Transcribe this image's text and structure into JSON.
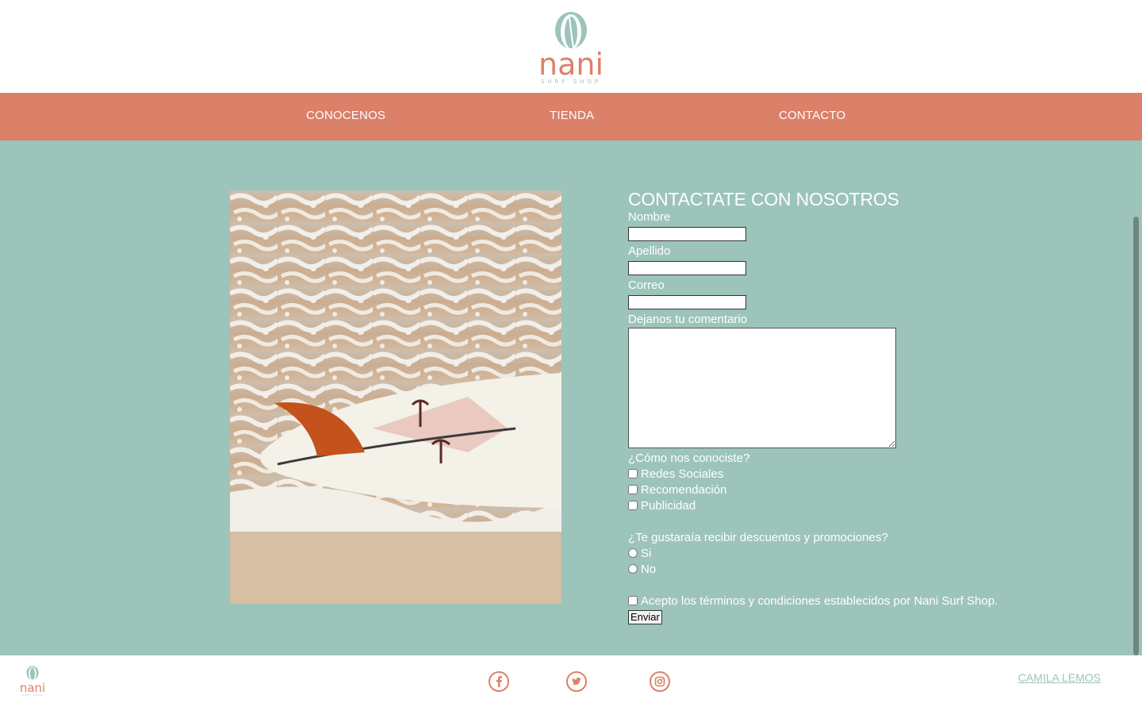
{
  "brand": {
    "name": "nani",
    "tagline": "SURF SHOP"
  },
  "nav": {
    "items": [
      {
        "label": "CONOCENOS"
      },
      {
        "label": "TIENDA"
      },
      {
        "label": "CONTACTO"
      }
    ]
  },
  "colors": {
    "accent": "#db8069",
    "mint": "#9cc4ba"
  },
  "form": {
    "title": "CONTACTATE CON NOSOTROS",
    "nombre_label": "Nombre",
    "apellido_label": "Apellido",
    "correo_label": "Correo",
    "comentario_label": "Dejanos tu comentario",
    "como_label": "¿Cómo nos conociste?",
    "como_options": [
      "Redes Sociales",
      "Recomendación",
      "Publicidad"
    ],
    "promo_label": "¿Te gustaraía recibir descuentos y promociones?",
    "promo_options": [
      "Si",
      "No"
    ],
    "terms_label": "Acepto los términos y condiciones establecidos por Nani Surf Shop.",
    "submit_label": "Enviar"
  },
  "footer": {
    "social_icons": [
      "facebook-icon",
      "twitter-icon",
      "instagram-icon"
    ],
    "author": "CAMILA LEMOS"
  }
}
